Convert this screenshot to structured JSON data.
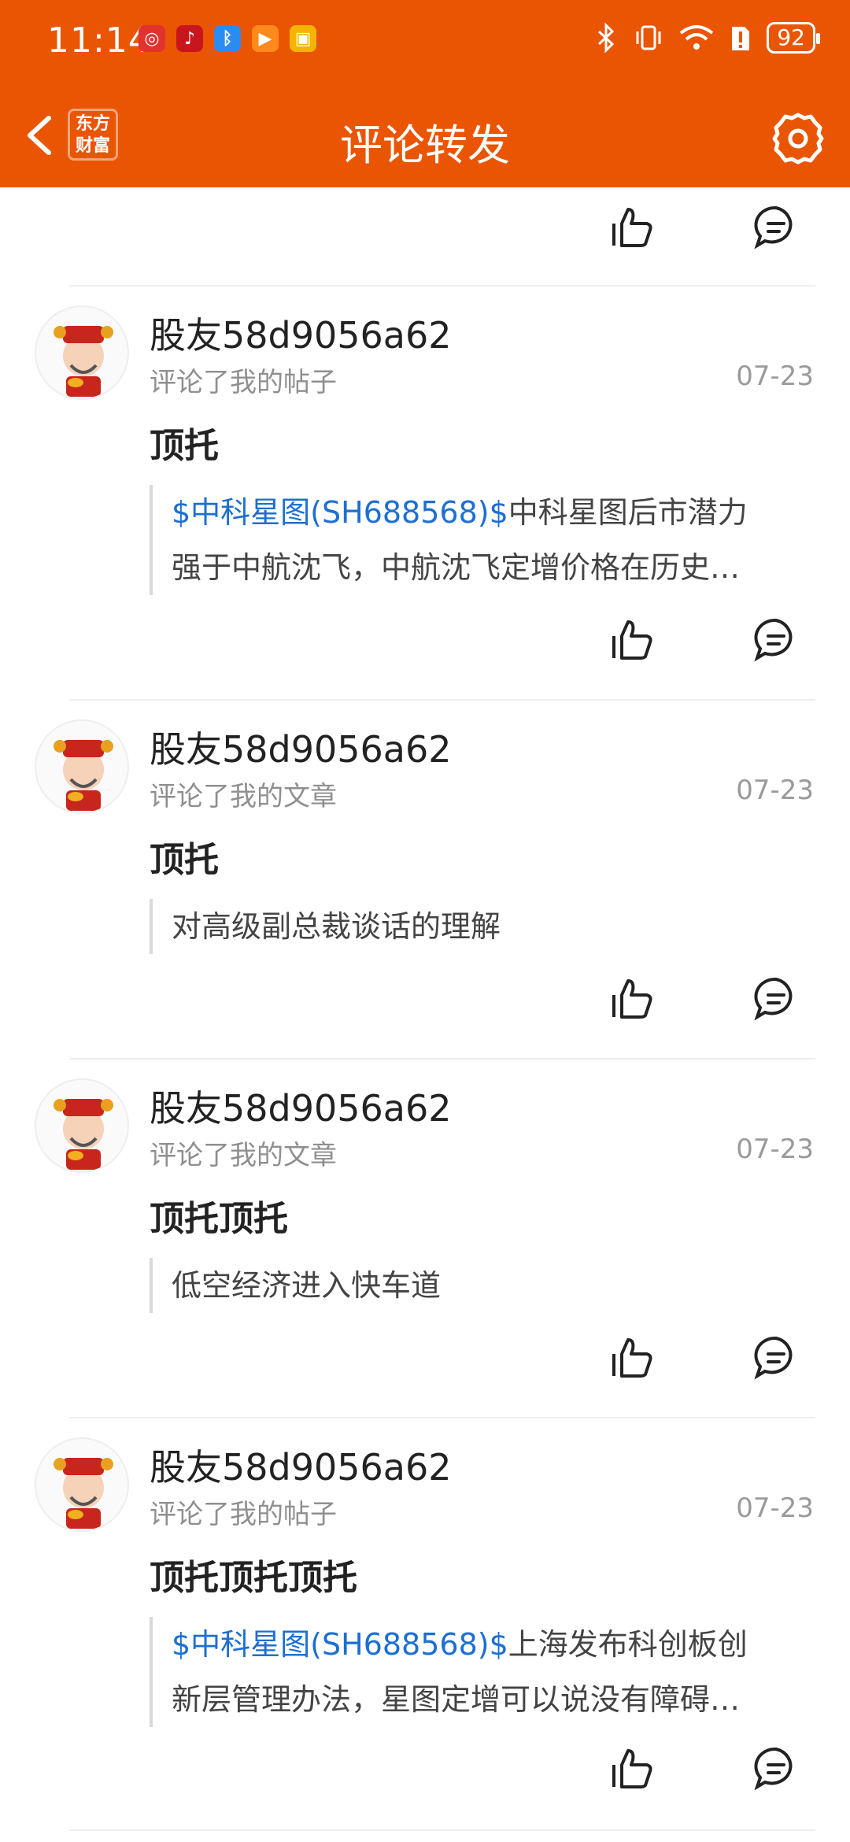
{
  "status_bar": {
    "time": "11:14",
    "battery": "92"
  },
  "header": {
    "title": "评论转发",
    "logo_line1": "东方",
    "logo_line2": "财富"
  },
  "items": [
    {
      "username": "股友58d9056a62",
      "action": "评论了我的帖子",
      "date": "07-23",
      "comment": "顶托",
      "quote_stock": "$中科星图(SH688568)$",
      "quote_line1": "中科星图后市潜力",
      "quote_line2": "强于中航沈飞，中航沈飞定增价格在历史…"
    },
    {
      "username": "股友58d9056a62",
      "action": "评论了我的文章",
      "date": "07-23",
      "comment": "顶托",
      "quote_text": "对高级副总裁谈话的理解"
    },
    {
      "username": "股友58d9056a62",
      "action": "评论了我的文章",
      "date": "07-23",
      "comment": "顶托顶托",
      "quote_text": "低空经济进入快车道"
    },
    {
      "username": "股友58d9056a62",
      "action": "评论了我的帖子",
      "date": "07-23",
      "comment": "顶托顶托顶托",
      "quote_stock": "$中科星图(SH688568)$",
      "quote_line1": "上海发布科创板创",
      "quote_line2": "新层管理办法，星图定增可以说没有障碍…"
    }
  ],
  "colors": {
    "brand": "#ea5504",
    "link": "#1d6fd1"
  }
}
